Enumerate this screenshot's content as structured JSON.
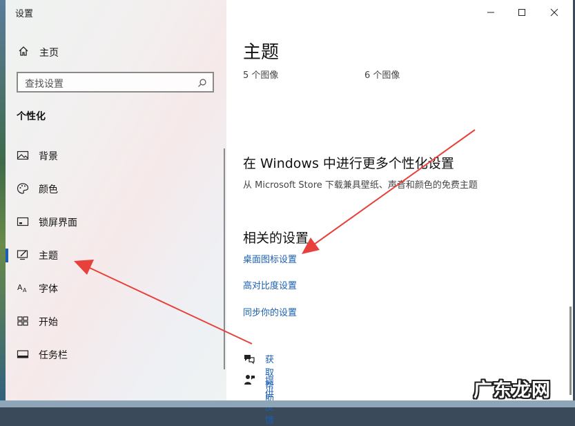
{
  "window": {
    "title": "设置"
  },
  "sidebar": {
    "home_label": "主页",
    "search_placeholder": "查找设置",
    "section_title": "个性化",
    "items": [
      {
        "label": "背景",
        "icon": "picture-icon",
        "active": false
      },
      {
        "label": "颜色",
        "icon": "palette-icon",
        "active": false
      },
      {
        "label": "锁屏界面",
        "icon": "lockscreen-icon",
        "active": false
      },
      {
        "label": "主题",
        "icon": "theme-icon",
        "active": true
      },
      {
        "label": "字体",
        "icon": "font-icon",
        "active": false
      },
      {
        "label": "开始",
        "icon": "start-icon",
        "active": false
      },
      {
        "label": "任务栏",
        "icon": "taskbar-icon",
        "active": false
      }
    ]
  },
  "main": {
    "title": "主题",
    "image_counts": [
      "5 个图像",
      "6 个图像"
    ],
    "more_title": "在 Windows 中进行更多个性化设置",
    "more_subtitle": "从 Microsoft Store 下载兼具壁纸、声音和颜色的免费主题",
    "related_title": "相关的设置",
    "related_links": [
      "桌面图标设置",
      "高对比度设置",
      "同步你的设置"
    ],
    "help": [
      {
        "label": "获取帮助",
        "icon": "help-chat-icon"
      },
      {
        "label": "提供反馈",
        "icon": "feedback-icon"
      }
    ]
  },
  "watermark": "广东龙网",
  "colors": {
    "accent": "#1a5fb4",
    "annotation_arrow": "#e8403a"
  }
}
